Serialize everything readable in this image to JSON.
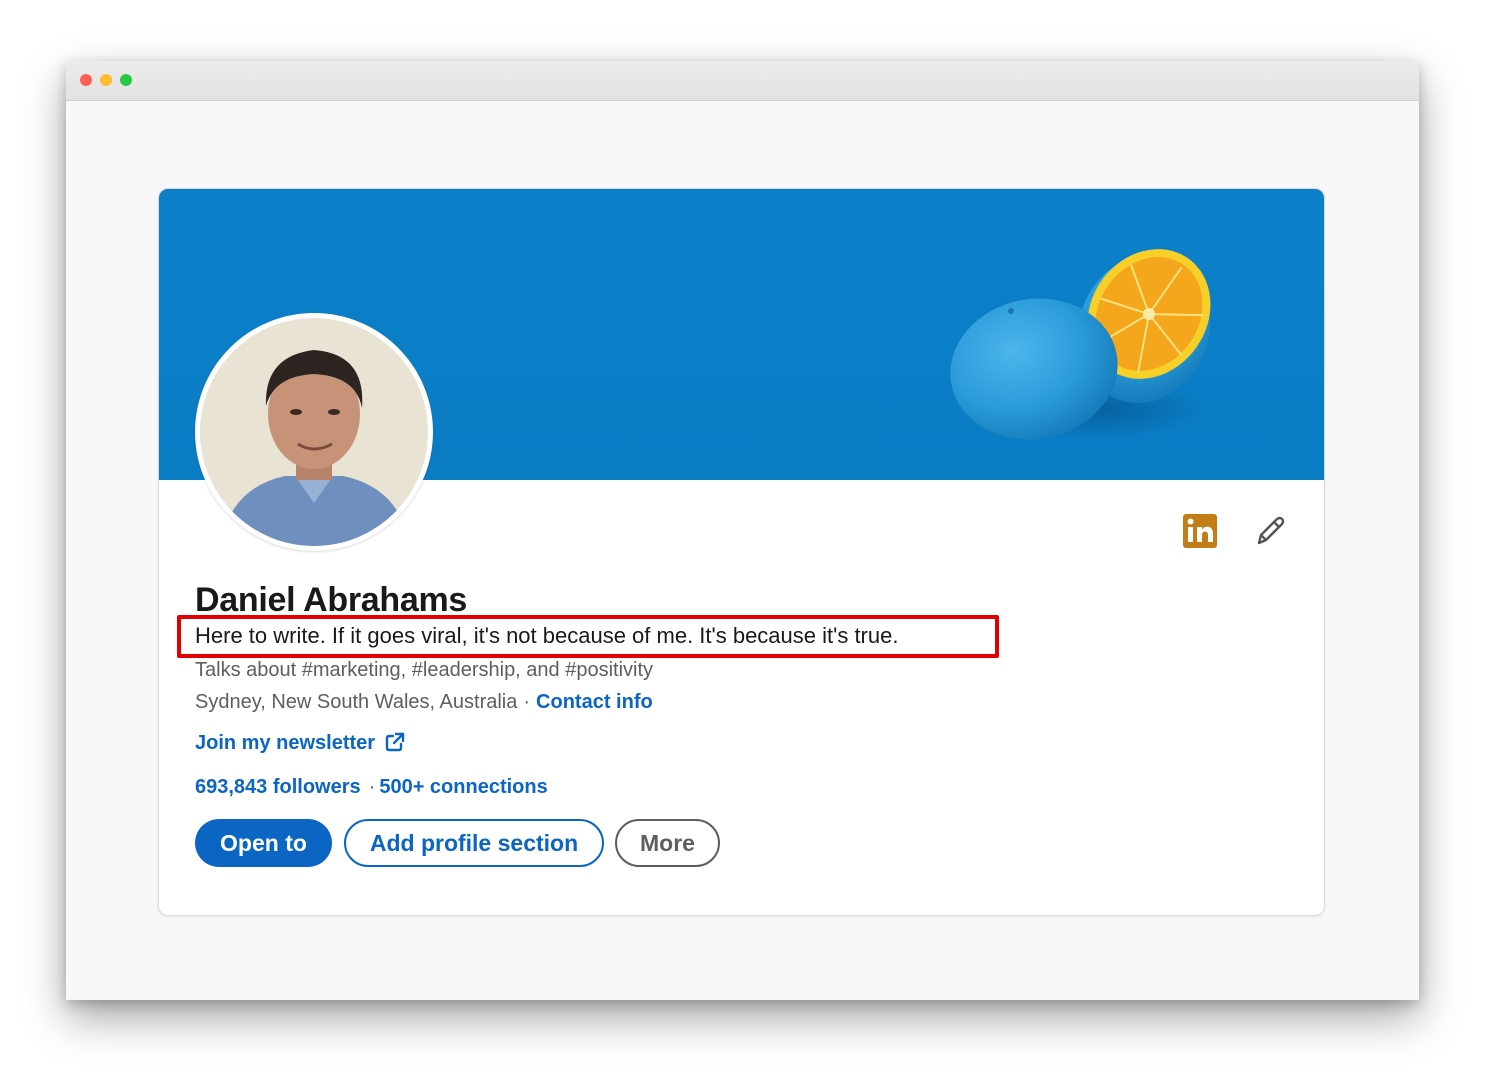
{
  "window": {
    "controls": [
      "close",
      "minimize",
      "maximize"
    ]
  },
  "profile": {
    "name": "Daniel Abrahams",
    "headline": "Here to write. If it goes viral, it's not because of me. It's because it's true.",
    "talks_about": "Talks about #marketing, #leadership, and #positivity",
    "location": "Sydney, New South Wales, Australia",
    "location_separator": "·",
    "contact_info": "Contact info",
    "newsletter_link": "Join my newsletter",
    "followers": "693,843 followers",
    "stats_separator": "·",
    "connections": "500+ connections"
  },
  "actions": {
    "open_to": "Open to",
    "add_profile_section": "Add profile section",
    "more": "More"
  },
  "icons": {
    "linkedin_badge": "linkedin-icon",
    "edit": "pencil-icon",
    "external_link": "external-link-icon"
  },
  "colors": {
    "banner": "#0a7cc4",
    "accent": "#0a66c2",
    "highlight_box": "#e00000",
    "linkedin_badge": "#c37d16"
  }
}
